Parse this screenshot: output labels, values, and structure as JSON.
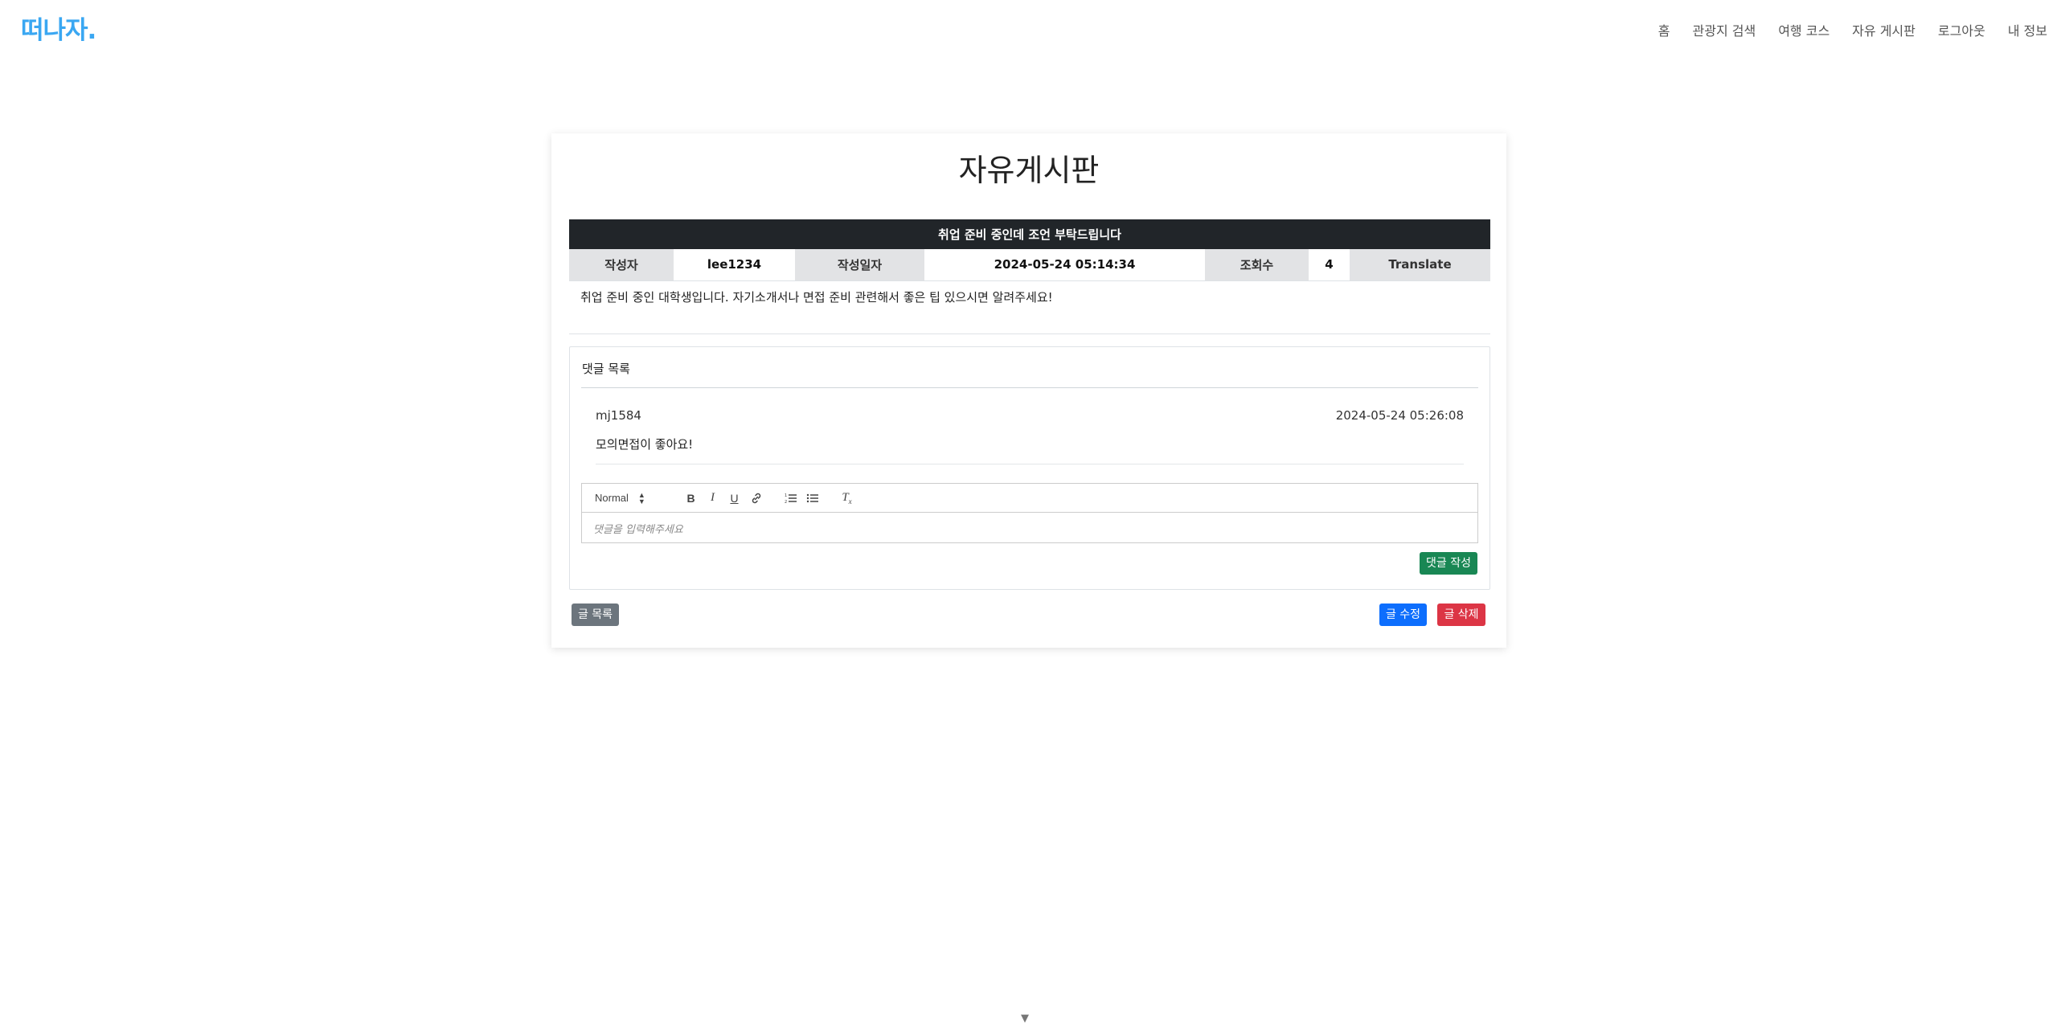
{
  "header": {
    "logo": "떠나자.",
    "nav": [
      "홈",
      "관광지 검색",
      "여행 코스",
      "자유 게시판",
      "로그아웃",
      "내 정보"
    ]
  },
  "page": {
    "title": "자유게시판"
  },
  "post": {
    "title": "취업 준비 중인데 조언 부탁드립니다",
    "author_label": "작성자",
    "author": "lee1234",
    "date_label": "작성일자",
    "date": "2024-05-24 05:14:34",
    "views_label": "조회수",
    "views": "4",
    "translate_label": "Translate",
    "content": "취업 준비 중인 대학생입니다. 자기소개서나 면접 준비 관련해서 좋은 팁 있으시면 알려주세요!"
  },
  "comments": {
    "header": "댓글 목록",
    "items": [
      {
        "author": "mj1584",
        "date": "2024-05-24 05:26:08",
        "text": "모의면접이 좋아요!"
      }
    ],
    "editor": {
      "format_select": "Normal",
      "placeholder": "댓글을 입력해주세요"
    },
    "submit_label": "댓글 작성"
  },
  "actions": {
    "list_label": "글 목록",
    "edit_label": "글 수정",
    "delete_label": "글 삭제"
  },
  "colors": {
    "logo": "#3aa7f2",
    "title_bar": "#212529",
    "success": "#198754",
    "primary": "#0d6efd",
    "danger": "#dc3545",
    "secondary": "#6c757d"
  }
}
